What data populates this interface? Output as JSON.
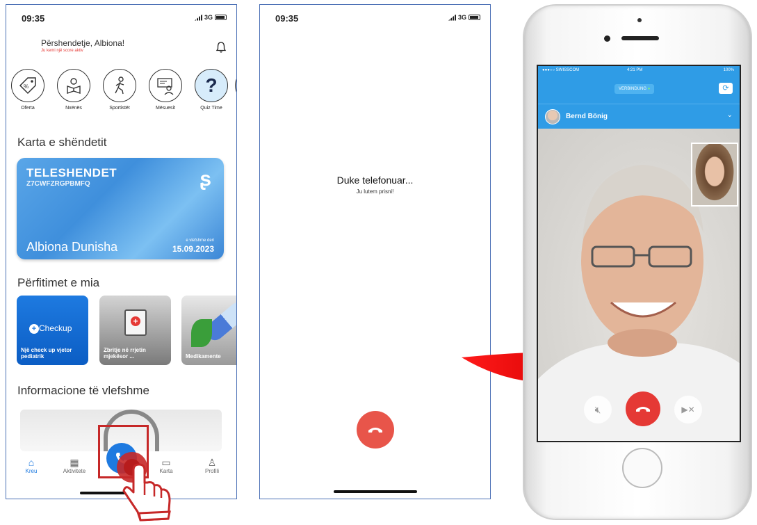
{
  "screen1": {
    "time": "09:35",
    "network": "3G",
    "greeting": "Përshendetje, Albiona!",
    "greeting_sub": "Ju kemi një score aktiv",
    "categories": [
      {
        "label": "Oferta",
        "icon": "tag-icon"
      },
      {
        "label": "Nxënës",
        "icon": "student-reading-icon"
      },
      {
        "label": "Sportistët",
        "icon": "athlete-icon"
      },
      {
        "label": "Mësuesit",
        "icon": "teacher-icon"
      },
      {
        "label": "Quiz Time",
        "icon": "question-icon"
      }
    ],
    "health_section_title": "Karta e shëndetit",
    "card": {
      "brand": "TELESHENDET",
      "code": "Z7CWFZRGPBMFQ",
      "holder": "Albiona Dunisha",
      "valid_label": "e vlefshme deri",
      "valid_date": "15.09.2023"
    },
    "benefits_title": "Përfitimet e mia",
    "benefits": [
      {
        "label": "Një check up vjetor pediatrik",
        "badge": "Checkup"
      },
      {
        "label": "Zbritje në rrjetin mjekësor ...",
        "badge": ""
      },
      {
        "label": "Medikamente",
        "badge": ""
      }
    ],
    "info_title": "Informacione të vlefshme",
    "tabs": [
      {
        "label": "Kreu",
        "icon": "home-icon",
        "active": true
      },
      {
        "label": "Aktivitete",
        "icon": "calendar-icon",
        "active": false
      },
      {
        "label": "",
        "icon": "phone-icon",
        "active": false
      },
      {
        "label": "Karta",
        "icon": "folder-icon",
        "active": false
      },
      {
        "label": "Profili",
        "icon": "person-icon",
        "active": false
      }
    ],
    "accent": "#1e7ae0"
  },
  "screen2": {
    "time": "09:35",
    "network": "3G",
    "calling_title": "Duke telefonuar...",
    "calling_sub": "Ju lutem prisni!",
    "end_color": "#e8554a"
  },
  "phone": {
    "carrier": "SWISSCOM",
    "time": "4:21 PM",
    "battery": "100%",
    "connection_label": "VERBINDUNG",
    "contact_name": "Bernd Bönig",
    "header_color": "#2f9ce6"
  }
}
